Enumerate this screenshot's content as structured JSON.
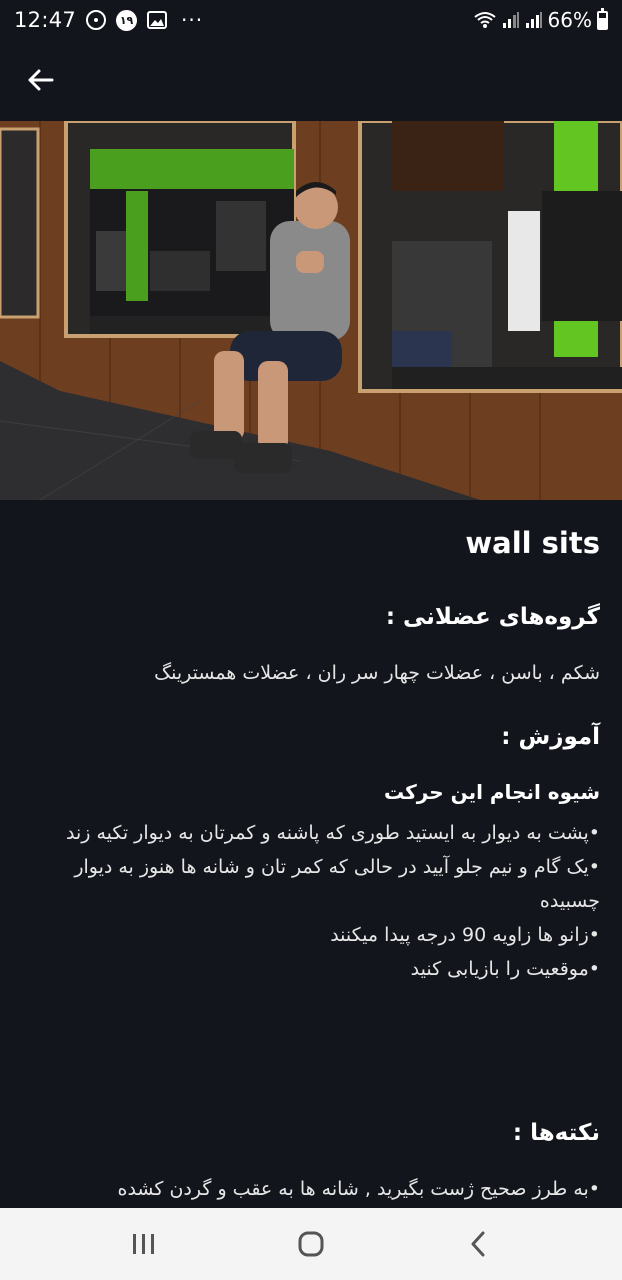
{
  "status_bar": {
    "time": "12:47",
    "badge_number": "۱۹",
    "more": "···",
    "battery": "66%",
    "battery_level": 0.66,
    "icons": [
      "circle-status-icon",
      "number-badge-icon",
      "image-icon",
      "wifi-icon",
      "signal-icon",
      "signal-icon",
      "battery-icon"
    ]
  },
  "app_bar": {
    "back_icon": "arrow-left-icon"
  },
  "exercise": {
    "name": "wall sits",
    "muscles_title": "گروه‌های عضلانی :",
    "muscles_text": "شکم ، باسن ، عضلات چهار سر ران ، عضلات همسترینگ",
    "tutorial_title": "آموزش :",
    "how_to_title": "شیوه انجام این حرکت",
    "steps": [
      "•پشت به دیوار به ایستید طوری که پاشنه و کمرتان به دیوار تکیه زند",
      "•یک گام و نیم جلو آیید در حالی که کمر تان و شانه ها هنوز به دیوار چسبیده",
      "•زانو ها زاویه 90 درجه پیدا میکنند",
      "•موقعیت را بازیابی کنید"
    ],
    "tips_title": "نکته‌ها :",
    "tips": [
      "•به طرز صحیح ژست بگیرید , شانه ها به عقب  و گردن کشده"
    ]
  },
  "nav_bar": {
    "icons": [
      "recent-apps-icon",
      "home-icon",
      "back-icon"
    ]
  },
  "colors": {
    "background": "#13151c",
    "wall_wood": "#7a4524",
    "accent_green": "#63c521",
    "nav_bg": "#f4f4f4"
  }
}
